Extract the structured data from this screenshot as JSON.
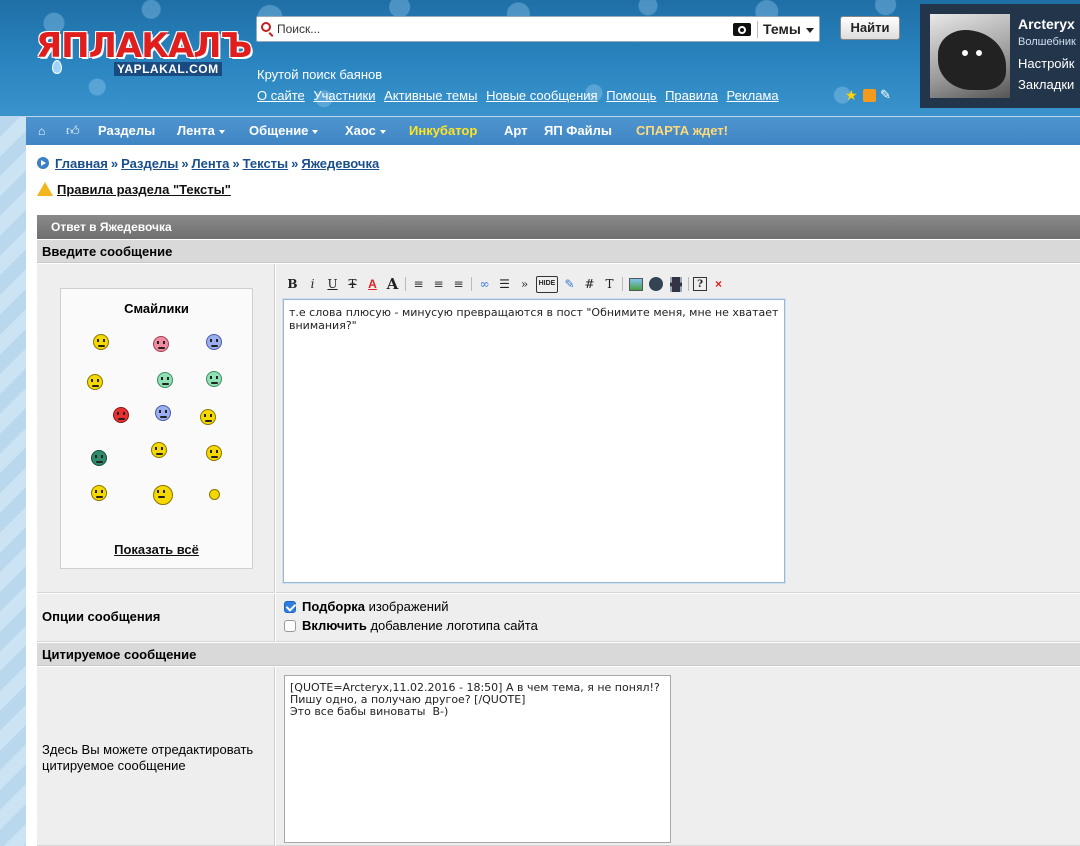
{
  "header": {
    "logo_main": "ЯПЛАКАЛЪ",
    "logo_sub": "YAPLAKAL.COM",
    "search_placeholder": "Поиск...",
    "topics_label": "Темы",
    "find_button": "Найти",
    "tagline": "Крутой поиск баянов",
    "links": [
      "О сайте",
      "Участники",
      "Активные темы",
      "Новые сообщения",
      "Помощь",
      "Правила",
      "Реклама"
    ]
  },
  "user": {
    "name": "Arcteryx",
    "rank": "Волшебник",
    "settings_link": "Настройк",
    "bookmarks_link": "Закладки"
  },
  "nav": {
    "sections": "Разделы",
    "feed": "Лента",
    "social": "Общение",
    "chaos": "Хаос",
    "incubator": "Инкубатор",
    "art": "Арт",
    "files": "ЯП Файлы",
    "sparta": "СПАРТА ждет!"
  },
  "breadcrumbs": [
    "Главная",
    "Разделы",
    "Лента",
    "Тексты",
    "Яжедевочка"
  ],
  "breadcrumb_sep": "»",
  "rules_link": "Правила раздела \"Тексты\"",
  "form": {
    "panel_title": "Ответ в Яжедевочка",
    "enter_message": "Введите сообщение",
    "smilies_title": "Смайлики",
    "show_all": "Показать всё",
    "message_text": "т.е слова плюсую - минусую превращаются в пост \"Обнимите меня, мне не хватает внимания?\"",
    "options_label": "Опции сообщения",
    "option1_bold": "Подборка",
    "option1_rest": " изображений",
    "option1_checked": true,
    "option2_bold": "Включить",
    "option2_rest": " добавление логотипа сайта",
    "option2_checked": false,
    "quoted_head": "Цитируемое сообщение",
    "quote_hint": "Здесь Вы можете отредактировать цитируемое сообщение",
    "quote_text": "[QUOTE=Arcteryx,11.02.2016 - 18:50] А в чем тема, я не понял!?\nПишу одно, а получаю другое? [/QUOTE]\nЭто все бабы виноваты  B-)"
  },
  "toolbar": {
    "bold": "B",
    "italic": "i",
    "underline": "U",
    "strike": "Ŧ",
    "color": "A",
    "size": "A",
    "quote": "»",
    "hide": "HIDE",
    "hash": "#",
    "text": "T",
    "help": "?",
    "close": "×"
  },
  "colors": {
    "header_blue": "#2a85c0",
    "nav_blue": "#4e94cf",
    "link_blue": "#1a4f8a",
    "incubator_yellow": "#ffe620"
  }
}
